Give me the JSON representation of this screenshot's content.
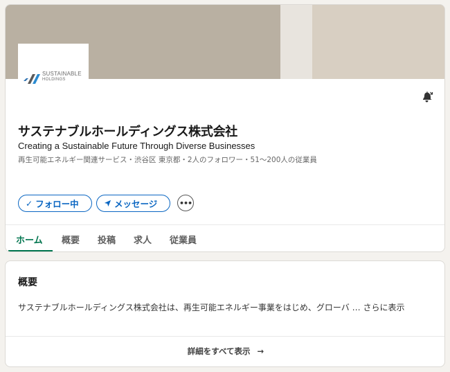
{
  "company": {
    "name": "サステナブルホールディングス株式会社",
    "tagline": "Creating a Sustainable Future Through Diverse Businesses",
    "meta": "再生可能エネルギー関連サービス・渋谷区 東京都・2人のフォロワー・51～200人の従業員",
    "logo_line1": "SUSTAINABLE",
    "logo_line2": "HOLDINGS"
  },
  "actions": {
    "follow_label": "フォロー中",
    "follow_icon": "✓",
    "message_label": "メッセージ",
    "message_icon": "send-icon",
    "more_label": "•••"
  },
  "tabs": [
    {
      "label": "ホーム",
      "active": true
    },
    {
      "label": "概要"
    },
    {
      "label": "投稿"
    },
    {
      "label": "求人"
    },
    {
      "label": "従業員"
    }
  ],
  "about": {
    "title": "概要",
    "text": "サステナブルホールディングス株式会社は、再生可能エネルギー事業をはじめ、グローバ … ",
    "show_more": "さらに表示",
    "all_details": "詳細をすべて表示",
    "arrow": "→"
  },
  "colors": {
    "accent": "#0a66c2",
    "tab_active": "#01754f",
    "banner": "#b9b0a2"
  }
}
